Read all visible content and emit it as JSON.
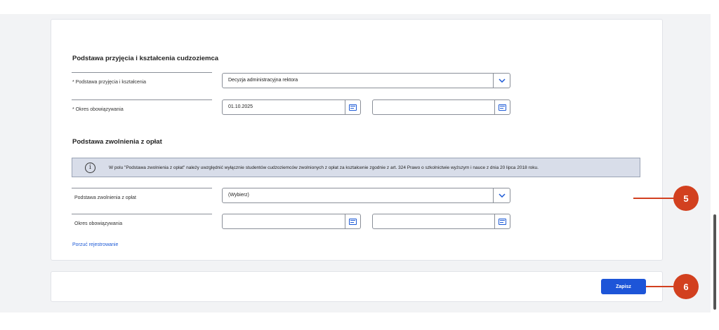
{
  "section1": {
    "title": "Podstawa przyjęcia i kształcenia cudzoziemca",
    "admission_label": "* Podstawa przyjęcia i kształcenia",
    "admission_value": "Decyzja administracyjna rektora",
    "validity_label": "* Okres obowiązywania",
    "validity_from": "01.10.2025",
    "validity_to": ""
  },
  "section2": {
    "title": "Podstawa zwolnienia z opłat",
    "info_text": "W polu \"Podstawa zwolnienia z opłat\" należy uwzględnić wyłącznie studentów cudzoziemców zwolnionych z opłat za kształcenie zgodnie z art. 324 Prawo o szkolnictwie wyższym i nauce z dnia 20 lipca 2018 roku.",
    "info_icon": "i",
    "exemption_label": "Podstawa zwolnienia z opłat",
    "exemption_value": "(Wybierz)",
    "validity_label": "Okres obowiązywania",
    "validity_from": "",
    "validity_to": ""
  },
  "abandon_link": "Porzuć rejestrowanie",
  "save_button": "Zapisz",
  "callouts": {
    "five": "5",
    "six": "6"
  },
  "colors": {
    "accent": "#1d55d8",
    "callout": "#d2401f",
    "info_bg": "#d8dde9"
  }
}
